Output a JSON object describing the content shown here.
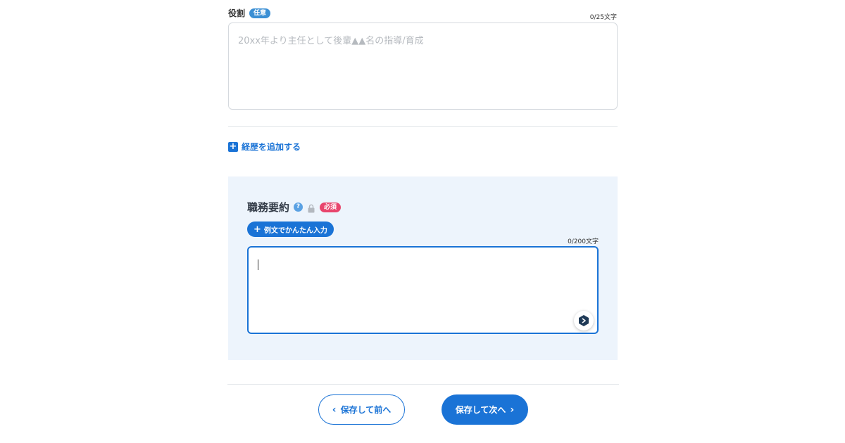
{
  "role_field": {
    "label": "役割",
    "badge": "任意",
    "counter": "0/25文字",
    "placeholder": "20xx年より主任として後輩▲▲名の指導/育成"
  },
  "add_career": {
    "icon": "plus-square-icon",
    "label": "経歴を追加する"
  },
  "summary": {
    "title": "職務要約",
    "help_icon": "question-icon",
    "lock_icon": "lock-icon",
    "badge": "必須",
    "example_button": "例文でかんたん入力",
    "counter": "0/200文字",
    "value": "",
    "assist_icon": "ai-assist-icon"
  },
  "footer": {
    "prev_label": "保存して前へ",
    "next_label": "保存して次へ"
  },
  "colors": {
    "primary": "#1a73d6",
    "panel_bg": "#edf4fc",
    "optional_badge": "#3b8fd4",
    "required_badge": "#e8456d"
  }
}
